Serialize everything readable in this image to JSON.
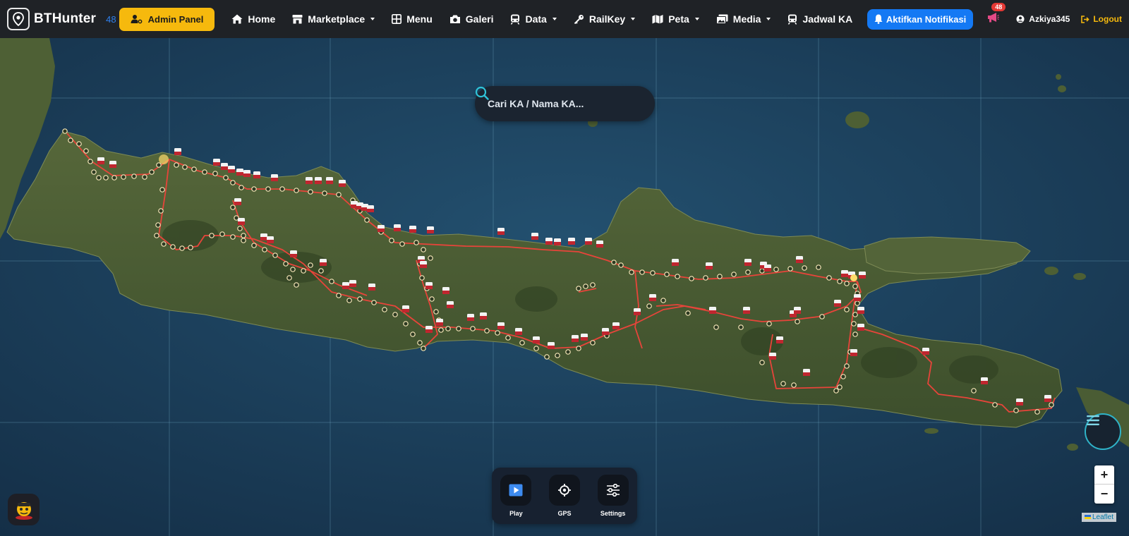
{
  "navbar": {
    "brand_name": "BTHunter",
    "brand_count": "48",
    "admin_label": "Admin Panel",
    "items": [
      {
        "label": "Home",
        "icon": "home-icon",
        "dropdown": false
      },
      {
        "label": "Marketplace",
        "icon": "store-icon",
        "dropdown": true
      },
      {
        "label": "Menu",
        "icon": "grid-icon",
        "dropdown": false
      },
      {
        "label": "Galeri",
        "icon": "camera-icon",
        "dropdown": false
      },
      {
        "label": "Data",
        "icon": "train-icon",
        "dropdown": true
      },
      {
        "label": "RailKey",
        "icon": "key-icon",
        "dropdown": true
      },
      {
        "label": "Peta",
        "icon": "map-icon",
        "dropdown": true
      },
      {
        "label": "Media",
        "icon": "images-icon",
        "dropdown": true
      },
      {
        "label": "Jadwal KA",
        "icon": "train-icon",
        "dropdown": false
      }
    ],
    "notif_label": "Aktifkan Notifikasi",
    "badge_count": "48",
    "username": "Azkiya345",
    "logout_label": "Logout"
  },
  "map": {
    "search_placeholder": "Cari KA / Nama KA...",
    "zoom_in": "+",
    "zoom_out": "−",
    "attribution": "Leaflet",
    "colors": {
      "rail": "#e8443a",
      "station_stroke": "#f5e6b8",
      "marker": "#c0262f",
      "land": "#4a5a2f",
      "sea": "#1c3f5c"
    }
  },
  "controls": [
    {
      "label": "Play",
      "icon": "play-icon"
    },
    {
      "label": "GPS",
      "icon": "gps-icon"
    },
    {
      "label": "Settings",
      "icon": "sliders-icon"
    }
  ]
}
